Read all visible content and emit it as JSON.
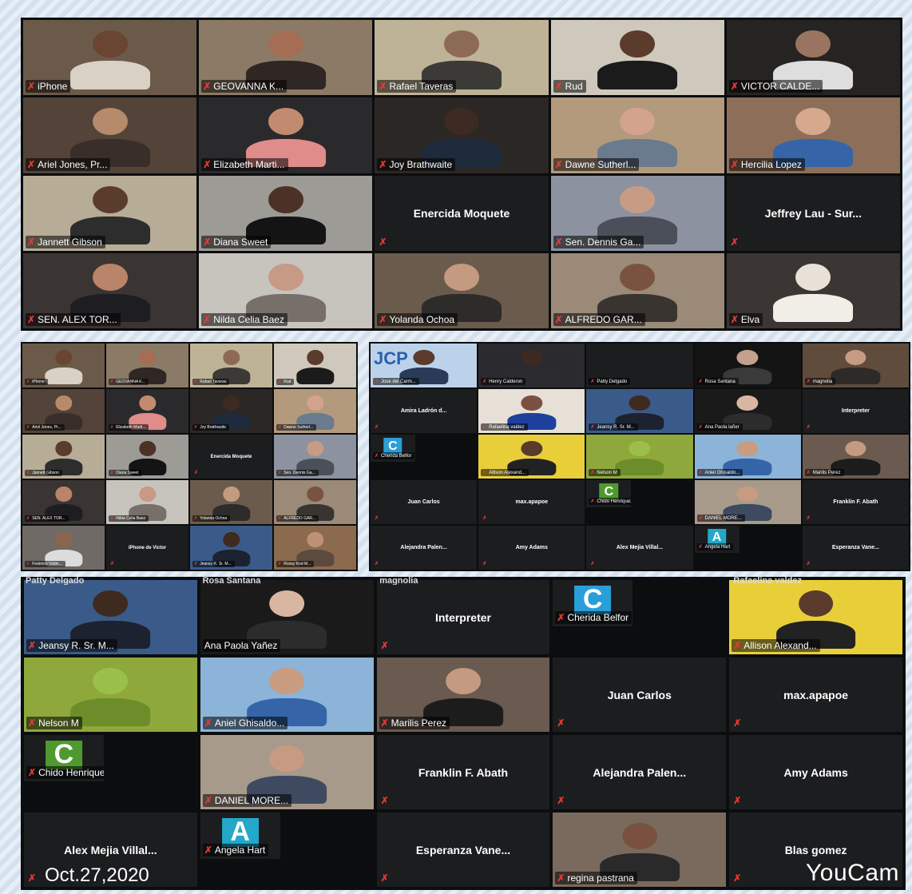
{
  "panels": [
    {
      "id": "p1",
      "tiles": [
        {
          "name": "iPhone",
          "kind": "video",
          "bg": "#6b5a4a",
          "skin": "#6a4632",
          "shirt": "#d8d1c4"
        },
        {
          "name": "GEOVANNA K...",
          "kind": "video",
          "bg": "#8a7a66",
          "skin": "#a56e54",
          "shirt": "#2f2724"
        },
        {
          "name": "Rafael Taveras",
          "kind": "video",
          "bg": "#bfb397",
          "skin": "#8d6a55",
          "shirt": "#3c3a37"
        },
        {
          "name": "Rud",
          "kind": "video",
          "bg": "#cfc9bd",
          "skin": "#5b3b2b",
          "shirt": "#1c1b1c"
        },
        {
          "name": "VICTOR CALDE...",
          "kind": "video",
          "bg": "#262422",
          "skin": "#9a7361",
          "shirt": "#dedede"
        },
        {
          "name": "Ariel Jones, Pr...",
          "kind": "video",
          "bg": "#534338",
          "skin": "#b58b6c",
          "shirt": "#3a2e2a"
        },
        {
          "name": "Elizabeth Marti...",
          "kind": "video",
          "bg": "#2a2a2c",
          "skin": "#c28b6f",
          "shirt": "#e08c8a"
        },
        {
          "name": "Joy Brathwaite",
          "kind": "video",
          "bg": "#2b2724",
          "skin": "#3d2a22",
          "shirt": "#1e2b3c"
        },
        {
          "name": "Dawne Sutherl...",
          "kind": "video",
          "bg": "#b39a7c",
          "skin": "#d3a38d",
          "shirt": "#6a7b8e"
        },
        {
          "name": "Hercilia Lopez",
          "kind": "video",
          "bg": "#8d6f59",
          "skin": "#d6a88d",
          "shirt": "#3565a8"
        },
        {
          "name": "Jannett Gibson",
          "kind": "video",
          "bg": "#b7ac96",
          "skin": "#5a3c2c",
          "shirt": "#2d2d2e"
        },
        {
          "name": "Diana Sweet",
          "kind": "video",
          "bg": "#9d9b96",
          "skin": "#4c3126",
          "shirt": "#141414"
        },
        {
          "name": "Enercida Moquete",
          "kind": "name"
        },
        {
          "name": "Sen. Dennis Ga...",
          "kind": "video",
          "bg": "#8c92a0",
          "skin": "#c89c84",
          "shirt": "#4b4f59"
        },
        {
          "name": "Jeffrey Lau - Sur...",
          "kind": "name"
        },
        {
          "name": "SEN. ALEX TOR...",
          "kind": "video",
          "bg": "#3a3432",
          "skin": "#b98469",
          "shirt": "#1d1d22"
        },
        {
          "name": "Nilda Celia Baez",
          "kind": "video",
          "bg": "#c7c4bd",
          "skin": "#c69a85",
          "shirt": "#77706a"
        },
        {
          "name": "Yolanda Ochoa",
          "kind": "video",
          "bg": "#6b5b4d",
          "skin": "#c49a80",
          "shirt": "#2e2b2b"
        },
        {
          "name": "ALFREDO GAR...",
          "kind": "video",
          "bg": "#9b8a78",
          "skin": "#7a5340",
          "shirt": "#3a3431"
        },
        {
          "name": "Elva",
          "kind": "video",
          "bg": "#3b3633",
          "skin": "#e7e1d8",
          "shirt": "#f1ede7"
        }
      ]
    },
    {
      "id": "p2",
      "tiles": [
        {
          "name": "iPhone",
          "kind": "video",
          "bg": "#6b5a4a",
          "skin": "#6a4632",
          "shirt": "#d8d1c4"
        },
        {
          "name": "GEOVANNA K...",
          "kind": "video",
          "bg": "#8a7a66",
          "skin": "#a56e54",
          "shirt": "#2f2724"
        },
        {
          "name": "Rafael Taveras",
          "kind": "video",
          "bg": "#bfb397",
          "skin": "#8d6a55",
          "shirt": "#3c3a37"
        },
        {
          "name": "Rud",
          "kind": "video",
          "bg": "#cfc9bd",
          "skin": "#5b3b2b",
          "shirt": "#1c1b1c"
        },
        {
          "name": "Ariel Jones, Pr...",
          "kind": "video",
          "bg": "#534338",
          "skin": "#b58b6c",
          "shirt": "#3a2e2a"
        },
        {
          "name": "Elizabeth Marti...",
          "kind": "video",
          "bg": "#2a2a2c",
          "skin": "#c28b6f",
          "shirt": "#e08c8a"
        },
        {
          "name": "Joy Brathwaite",
          "kind": "video",
          "bg": "#2b2724",
          "skin": "#3d2a22",
          "shirt": "#1e2b3c"
        },
        {
          "name": "Dawne Sutherl...",
          "kind": "video",
          "bg": "#b39a7c",
          "skin": "#d3a38d",
          "shirt": "#6a7b8e"
        },
        {
          "name": "Jannett Gibson",
          "kind": "video",
          "bg": "#b7ac96",
          "skin": "#5a3c2c",
          "shirt": "#2d2d2e"
        },
        {
          "name": "Diana Sweet",
          "kind": "video",
          "bg": "#9d9b96",
          "skin": "#4c3126",
          "shirt": "#141414"
        },
        {
          "name": "Enercida Moquete",
          "kind": "name"
        },
        {
          "name": "Sen. Dennis Ga...",
          "kind": "video",
          "bg": "#8c92a0",
          "skin": "#c89c84",
          "shirt": "#4b4f59"
        },
        {
          "name": "SEN. ALEX TOR...",
          "kind": "video",
          "bg": "#3a3432",
          "skin": "#b98469",
          "shirt": "#1d1d22"
        },
        {
          "name": "Nilda Celia Baez",
          "kind": "video",
          "bg": "#c7c4bd",
          "skin": "#c69a85",
          "shirt": "#77706a"
        },
        {
          "name": "Yolanda Ochoa",
          "kind": "video",
          "bg": "#6b5b4d",
          "skin": "#c49a80",
          "shirt": "#2e2b2b"
        },
        {
          "name": "ALFREDO GAR...",
          "kind": "video",
          "bg": "#9b8a78",
          "skin": "#7a5340",
          "shirt": "#3a3431"
        },
        {
          "name": "Federico Valde...",
          "kind": "video",
          "bg": "#6f6a66",
          "skin": "#8a6550",
          "shirt": "#dcdcdc"
        },
        {
          "name": "iPhone de Victor",
          "kind": "name"
        },
        {
          "name": "Jeansy R. Sr. M...",
          "kind": "video",
          "bg": "#3a5b8a",
          "skin": "#3f2a20",
          "shirt": "#1d2230",
          "active": true
        },
        {
          "name": "Rossy Rod M...",
          "kind": "video",
          "bg": "#8b6a4e",
          "skin": "#c09076",
          "shirt": "#5b4a40"
        }
      ]
    },
    {
      "id": "p3",
      "tiles": [
        {
          "name": "Jose del Carm...",
          "kind": "video",
          "bg": "#bcd2ea",
          "skin": "#5a3b2c",
          "shirt": "#2a3b59",
          "logo": "JCP"
        },
        {
          "name": "Henry Calderon",
          "kind": "video",
          "bg": "#2b2a2e",
          "skin": "#3c2a22",
          "shirt": "#2c2c30"
        },
        {
          "name": "Patty Delgado",
          "kind": "name",
          "blank": true
        },
        {
          "name": "Rosa Santana",
          "kind": "video",
          "bg": "#141414",
          "skin": "#c5a08c",
          "shirt": "#3a3a3a"
        },
        {
          "name": "magnolia",
          "kind": "video",
          "bg": "#5f4c3d",
          "skin": "#c79b81",
          "shirt": "#2e2a27"
        },
        {
          "name": "Amira Ladrón d...",
          "kind": "name"
        },
        {
          "name": "Rafaelina valdez",
          "kind": "video",
          "bg": "#e6e0d6",
          "skin": "#7a5140",
          "shirt": "#1d3f9e"
        },
        {
          "name": "Jeansy R. Sr. M...",
          "kind": "video",
          "bg": "#3a5b8a",
          "skin": "#3f2a20",
          "shirt": "#1d2230"
        },
        {
          "name": "Ana Paola Iañer",
          "kind": "video",
          "bg": "#1a1a1a",
          "skin": "#d8b6a2",
          "shirt": "#2c2c2c"
        },
        {
          "name": "Interpreter",
          "kind": "name"
        },
        {
          "name": "Cherida Belfor",
          "kind": "avatar",
          "letter": "C",
          "color": "#2a9ed8"
        },
        {
          "name": "Allison Alexand...",
          "kind": "video",
          "bg": "#e8cf3a",
          "skin": "#5a3b2b",
          "shirt": "#222"
        },
        {
          "name": "Nelson M",
          "kind": "video",
          "bg": "#8fa83c",
          "skin": "#9bc04a",
          "shirt": "#6d8d2a"
        },
        {
          "name": "Aniel Ghisaldo...",
          "kind": "video",
          "bg": "#8cb4d8",
          "skin": "#c99b80",
          "shirt": "#3565a8"
        },
        {
          "name": "Marilis Perez",
          "kind": "video",
          "bg": "#6a5a50",
          "skin": "#c49a80",
          "shirt": "#1c1c1c"
        },
        {
          "name": "Juan Carlos",
          "kind": "name"
        },
        {
          "name": "max.apapoe",
          "kind": "name"
        },
        {
          "name": "Chido Henriquez",
          "kind": "avatar",
          "letter": "C",
          "color": "#4f9a2e"
        },
        {
          "name": "DANIEL MORE...",
          "kind": "video",
          "bg": "#a89a8a",
          "skin": "#c79b82",
          "shirt": "#3d4a5f"
        },
        {
          "name": "Franklin F. Abath",
          "kind": "name"
        },
        {
          "name": "Alejandra  Palen...",
          "kind": "name"
        },
        {
          "name": "Amy Adams",
          "kind": "name"
        },
        {
          "name": "Alex Mejia Villal...",
          "kind": "name"
        },
        {
          "name": "Angela Hart",
          "kind": "avatar",
          "letter": "A",
          "color": "#23a8c9"
        },
        {
          "name": "Esperanza  Vane...",
          "kind": "name"
        }
      ]
    },
    {
      "id": "p4",
      "tiles": [
        {
          "name": "Jeansy R. Sr. M...",
          "kind": "video",
          "bg": "#3a5b8a",
          "skin": "#3f2a20",
          "shirt": "#1d2230"
        },
        {
          "name": "Ana Paola Yañez",
          "kind": "video",
          "bg": "#1a1a1a",
          "skin": "#d8b6a2",
          "shirt": "#2c2c2c",
          "nomic": true
        },
        {
          "name": "Interpreter",
          "kind": "name"
        },
        {
          "name": "Cherida Belfor",
          "kind": "avatar",
          "letter": "C",
          "color": "#2a9ed8"
        },
        {
          "name": "Allison Alexand...",
          "kind": "video",
          "bg": "#e8cf3a",
          "skin": "#5a3b2b",
          "shirt": "#222"
        },
        {
          "name": "Nelson M",
          "kind": "video",
          "bg": "#8fa83c",
          "skin": "#9bc04a",
          "shirt": "#6d8d2a"
        },
        {
          "name": "Aniel Ghisaldo...",
          "kind": "video",
          "bg": "#8cb4d8",
          "skin": "#c99b80",
          "shirt": "#3565a8"
        },
        {
          "name": "Marilis Perez",
          "kind": "video",
          "bg": "#6a5a50",
          "skin": "#c49a80",
          "shirt": "#1c1c1c"
        },
        {
          "name": "Juan Carlos",
          "kind": "name"
        },
        {
          "name": "max.apapoe",
          "kind": "name"
        },
        {
          "name": "Chido Henriquez",
          "kind": "avatar",
          "letter": "C",
          "color": "#4f9a2e"
        },
        {
          "name": "DANIEL MORE...",
          "kind": "video",
          "bg": "#a89a8a",
          "skin": "#c79b82",
          "shirt": "#3d4a5f"
        },
        {
          "name": "Franklin F. Abath",
          "kind": "name"
        },
        {
          "name": "Alejandra  Palen...",
          "kind": "name"
        },
        {
          "name": "Amy Adams",
          "kind": "name"
        },
        {
          "name": "Alex Mejia Villal...",
          "kind": "name"
        },
        {
          "name": "Angela Hart",
          "kind": "avatar",
          "letter": "A",
          "color": "#23a8c9"
        },
        {
          "name": "Esperanza  Vane...",
          "kind": "name"
        },
        {
          "name": "regina pastrana",
          "kind": "video",
          "bg": "#7a6a5e",
          "skin": "#7a5140",
          "shirt": "#2a2a2a"
        },
        {
          "name": "Blas gomez",
          "kind": "name"
        }
      ]
    }
  ],
  "p4_top_labels": [
    "Patty Delgado",
    "Rosa Santana",
    "magnolia",
    "",
    "Rafaelina valdez"
  ],
  "date_stamp": "Oct.27,2020",
  "watermark": "YouCam",
  "mic_icon": "muted-mic-icon"
}
